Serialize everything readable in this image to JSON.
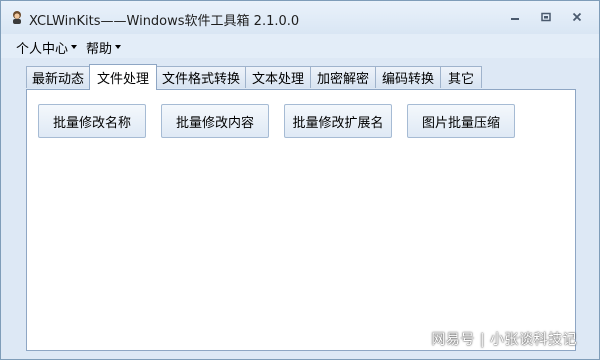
{
  "window": {
    "title": "XCLWinKits——Windows软件工具箱 2.1.0.0",
    "icon": "app-icon"
  },
  "menu": {
    "items": [
      {
        "label": "个人中心"
      },
      {
        "label": "帮助"
      }
    ]
  },
  "tabs": [
    {
      "label": "最新动态",
      "active": false
    },
    {
      "label": "文件处理",
      "active": true
    },
    {
      "label": "文件格式转换",
      "active": false
    },
    {
      "label": "文本处理",
      "active": false
    },
    {
      "label": "加密解密",
      "active": false
    },
    {
      "label": "编码转换",
      "active": false
    },
    {
      "label": "其它",
      "active": false
    }
  ],
  "buttons": [
    {
      "label": "批量修改名称"
    },
    {
      "label": "批量修改内容"
    },
    {
      "label": "批量修改扩展名"
    },
    {
      "label": "图片批量压缩"
    }
  ],
  "watermark": "网易号 | 小张谈科技记",
  "colors": {
    "window_bg": "#dde8f5",
    "panel_bg": "#ffffff",
    "border": "#8ea6c4"
  }
}
